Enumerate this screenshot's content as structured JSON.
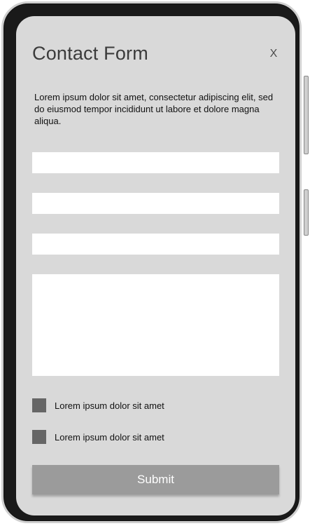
{
  "form": {
    "title": "Contact Form",
    "close_label": "X",
    "description": "Lorem ipsum dolor sit amet, consectetur adipiscing elit, sed do eiusmod tempor incididunt ut labore et dolore magna aliqua.",
    "fields": [
      {
        "value": "",
        "placeholder": ""
      },
      {
        "value": "",
        "placeholder": ""
      },
      {
        "value": "",
        "placeholder": ""
      }
    ],
    "message": {
      "value": "",
      "placeholder": ""
    },
    "checkboxes": [
      {
        "label": "Lorem ipsum dolor sit amet",
        "checked": false
      },
      {
        "label": "Lorem ipsum dolor sit amet",
        "checked": false
      }
    ],
    "submit_label": "Submit"
  },
  "colors": {
    "screen_background": "#d9d9d9",
    "field_background": "#ffffff",
    "checkbox": "#666666",
    "submit_background": "#9b9b9b",
    "submit_text": "#ffffff",
    "device_frame": "#1a1a1a"
  }
}
